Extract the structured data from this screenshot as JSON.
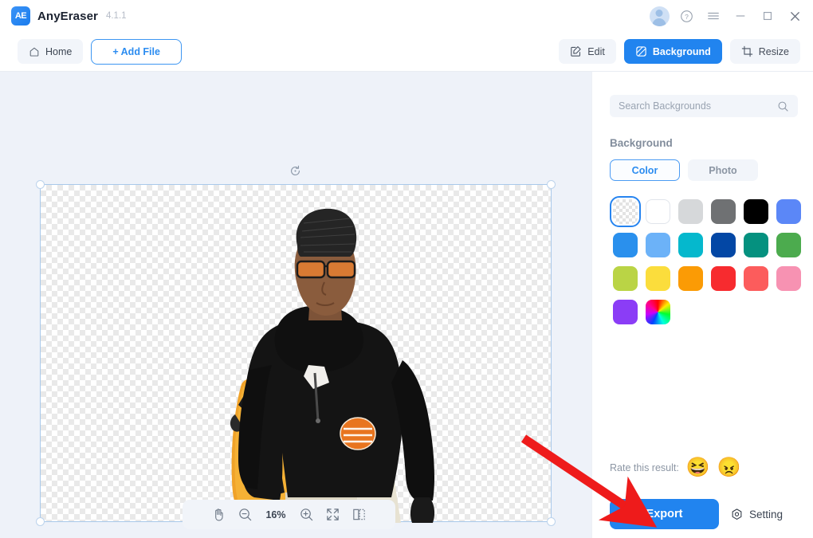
{
  "titlebar": {
    "app_name": "AnyEraser",
    "version": "4.1.1",
    "logo_text": "AE",
    "controls": [
      {
        "name": "avatar",
        "label": ""
      },
      {
        "name": "help-icon",
        "label": "?"
      },
      {
        "name": "menu-icon",
        "label": "☰"
      },
      {
        "name": "minimize-icon",
        "label": "–"
      },
      {
        "name": "maximize-icon",
        "label": "□"
      },
      {
        "name": "close-icon",
        "label": "✕"
      }
    ]
  },
  "toolbar": {
    "home_label": "Home",
    "add_file_label": "+ Add File",
    "edit_label": "Edit",
    "background_label": "Background",
    "resize_label": "Resize",
    "active_tab": "Background"
  },
  "canvas": {
    "reset_icon": "reset-icon",
    "zoom_level": "16%",
    "tools": [
      {
        "name": "pan-tool-icon",
        "label": "hand"
      },
      {
        "name": "zoom-out-icon",
        "label": "minus"
      },
      {
        "name": "zoom-in-icon",
        "label": "plus"
      },
      {
        "name": "fit-screen-icon",
        "label": "expand"
      },
      {
        "name": "compare-view-icon",
        "label": "split"
      }
    ]
  },
  "panel": {
    "search_placeholder": "Search Backgrounds",
    "search_value": "",
    "heading": "Background",
    "tabs": [
      {
        "label": "Color",
        "active": true
      },
      {
        "label": "Photo",
        "active": false
      }
    ],
    "swatches": [
      {
        "name": "transparent",
        "color": "transparent",
        "selected": true
      },
      {
        "name": "white",
        "color": "#ffffff",
        "selected": false
      },
      {
        "name": "light-gray",
        "color": "#d6d8da",
        "selected": false
      },
      {
        "name": "dark-gray",
        "color": "#6f7173",
        "selected": false
      },
      {
        "name": "black",
        "color": "#000000",
        "selected": false
      },
      {
        "name": "royal-blue",
        "color": "#5b87f7",
        "selected": false
      },
      {
        "name": "blue",
        "color": "#2a90ed",
        "selected": false
      },
      {
        "name": "sky-blue",
        "color": "#6cb2f8",
        "selected": false
      },
      {
        "name": "cyan",
        "color": "#05b8cd",
        "selected": false
      },
      {
        "name": "navy",
        "color": "#0347a5",
        "selected": false
      },
      {
        "name": "teal",
        "color": "#05917f",
        "selected": false
      },
      {
        "name": "green",
        "color": "#4cab4e",
        "selected": false
      },
      {
        "name": "lime",
        "color": "#bad445",
        "selected": false
      },
      {
        "name": "yellow",
        "color": "#fbdd3c",
        "selected": false
      },
      {
        "name": "orange",
        "color": "#fb9b05",
        "selected": false
      },
      {
        "name": "red",
        "color": "#f72b2f",
        "selected": false
      },
      {
        "name": "coral",
        "color": "#fc5c5c",
        "selected": false
      },
      {
        "name": "pink",
        "color": "#f792b2",
        "selected": false
      },
      {
        "name": "purple",
        "color": "#8b3df6",
        "selected": false
      },
      {
        "name": "rainbow-picker",
        "color": "rainbow",
        "selected": false
      }
    ],
    "rate_label": "Rate this result:",
    "rate_happy": "😆",
    "rate_angry": "😠",
    "export_label": "Export",
    "setting_label": "Setting"
  },
  "colors": {
    "accent": "#2184ef",
    "accent_light": "#4b9bf3",
    "canvas_bg": "#eef2f9",
    "panel_bg": "#ffffff",
    "arrow": "#ee1b1b"
  }
}
